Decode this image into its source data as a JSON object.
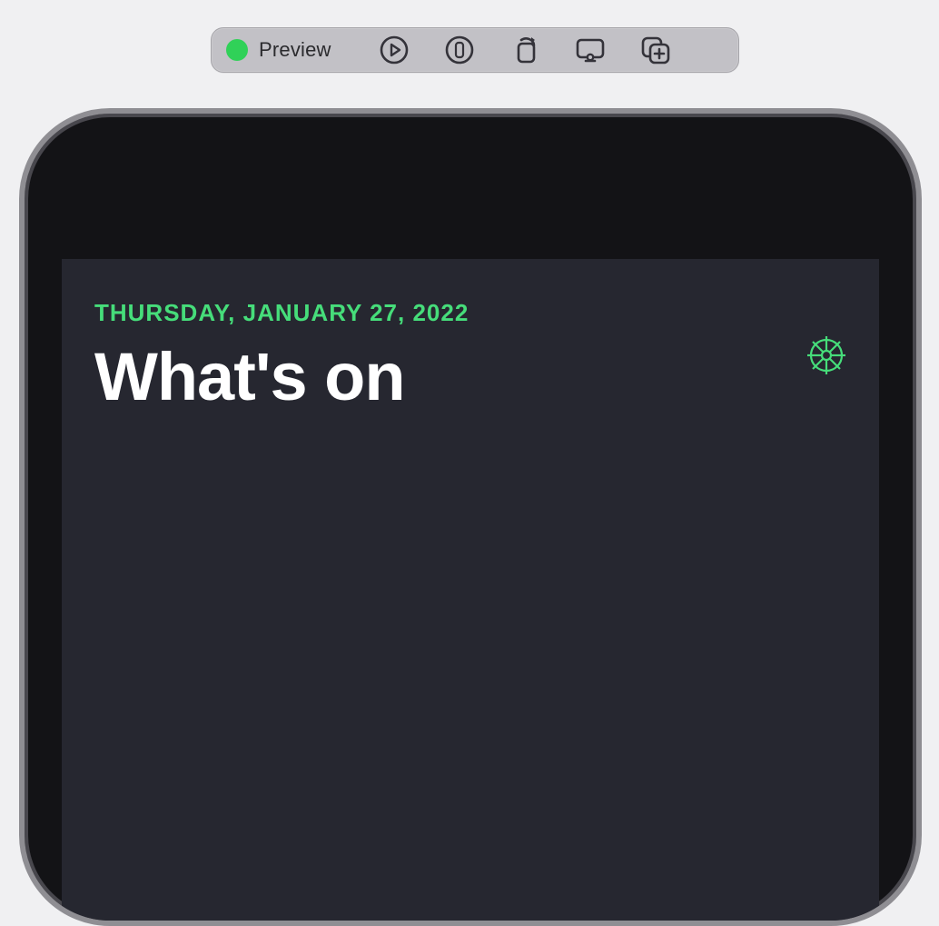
{
  "toolbar": {
    "status_label": "Preview",
    "status_color": "#30d158",
    "icons": {
      "play": "play-icon",
      "live": "live-preview-icon",
      "rotate": "rotate-device-icon",
      "display": "device-settings-icon",
      "variants": "add-preview-variant-icon"
    }
  },
  "app": {
    "date_line": "THURSDAY, JANUARY 27, 2022",
    "headline": "What's on",
    "accent_color": "#46dd7a",
    "background_color": "#262730"
  }
}
